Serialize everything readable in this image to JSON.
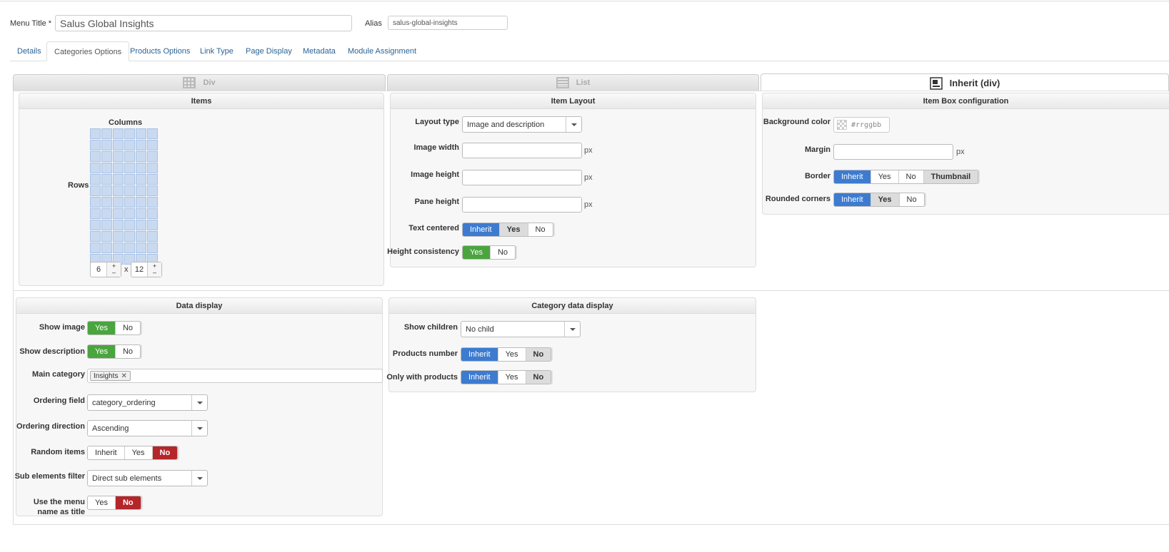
{
  "header": {
    "menu_title_label": "Menu Title *",
    "menu_title_value": "Salus Global Insights",
    "alias_label": "Alias",
    "alias_value": "salus-global-insights"
  },
  "tabs": [
    "Details",
    "Categories Options",
    "Products Options",
    "Link Type",
    "Page Display",
    "Metadata",
    "Module Assignment"
  ],
  "active_tab": "Categories Options",
  "layout_modes": [
    "Div",
    "List",
    "Inherit (div)"
  ],
  "active_layout_mode": "Inherit (div)",
  "items_panel": {
    "title": "Items",
    "columns_label": "Columns",
    "rows_label": "Rows",
    "columns_value": "6",
    "times": "x",
    "rows_value": "12"
  },
  "item_layout": {
    "title": "Item Layout",
    "layout_type_label": "Layout type",
    "layout_type_value": "Image and description",
    "image_width_label": "Image width",
    "image_height_label": "Image height",
    "pane_height_label": "Pane height",
    "unit": "px",
    "text_centered_label": "Text centered",
    "height_consistency_label": "Height consistency"
  },
  "item_box": {
    "title": "Item Box configuration",
    "background_color_label": "Background color",
    "background_color_placeholder": "#rrggbb",
    "margin_label": "Margin",
    "unit": "px",
    "border_label": "Border",
    "rounded_corners_label": "Rounded corners"
  },
  "data_display": {
    "title": "Data display",
    "show_image_label": "Show image",
    "show_description_label": "Show description",
    "main_category_label": "Main category",
    "main_category_tag": "Insights",
    "ordering_field_label": "Ordering field",
    "ordering_field_value": "category_ordering",
    "ordering_direction_label": "Ordering direction",
    "ordering_direction_value": "Ascending",
    "random_items_label": "Random items",
    "sub_elements_filter_label": "Sub elements filter",
    "sub_elements_filter_value": "Direct sub elements",
    "use_menu_name_label_1": "Use the menu",
    "use_menu_name_label_2": "name as title"
  },
  "category_data": {
    "title": "Category data display",
    "show_children_label": "Show children",
    "show_children_value": "No child",
    "products_number_label": "Products number",
    "only_with_products_label": "Only with products"
  },
  "options": {
    "inherit": "Inherit",
    "yes": "Yes",
    "no": "No",
    "thumbnail": "Thumbnail"
  },
  "colors": {
    "blue": "#3d7bd0",
    "green": "#4aa53e",
    "red": "#b4262a",
    "link": "#2a6496"
  },
  "icons": {
    "remove": "✕"
  }
}
